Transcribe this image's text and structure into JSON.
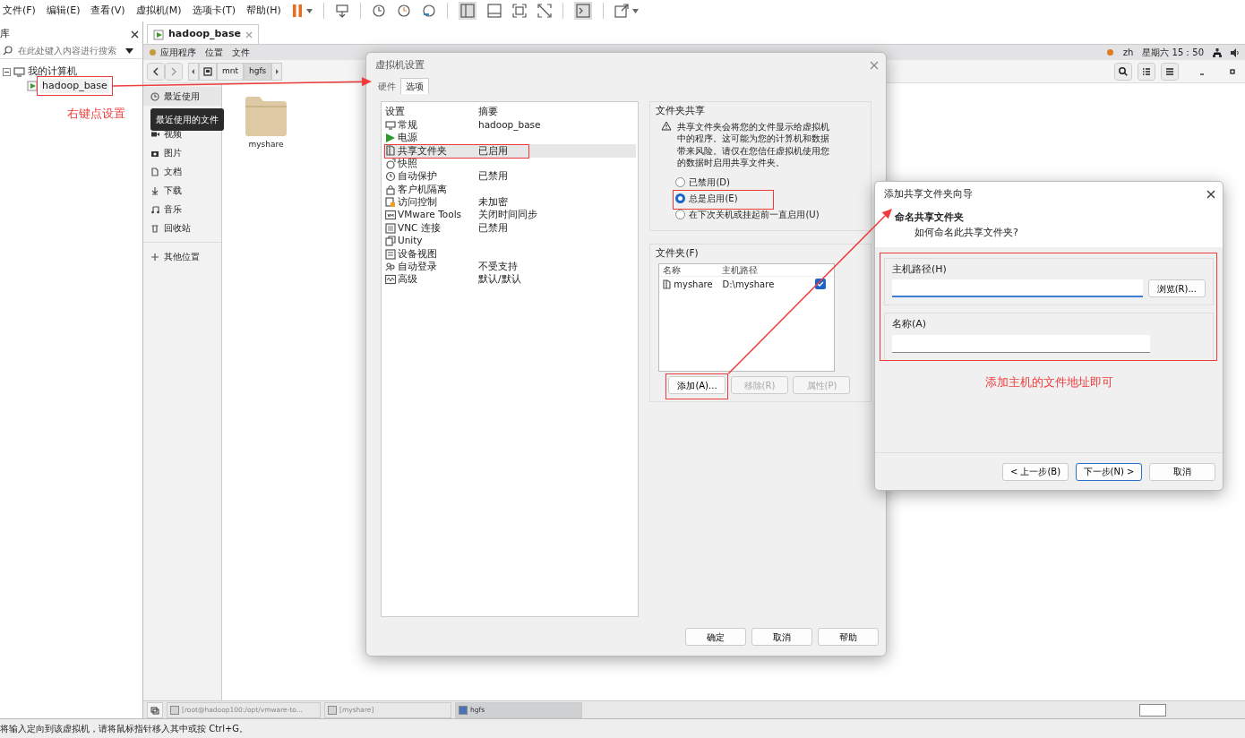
{
  "menubar": {
    "items": [
      "文件(F)",
      "编辑(E)",
      "查看(V)",
      "虚拟机(M)",
      "选项卡(T)",
      "帮助(H)"
    ]
  },
  "library": {
    "title": "库",
    "search": {
      "placeholder": "在此处键入内容进行搜索"
    },
    "tree": [
      {
        "label": "我的计算机",
        "expanded": true,
        "children": [
          {
            "label": "hadoop_base",
            "selected": false
          }
        ]
      }
    ],
    "note": "右键点设置"
  },
  "vm_tabs": [
    {
      "label": "hadoop_base",
      "selected": true
    }
  ],
  "guest_topbar": {
    "menus": [
      "应用程序",
      "位置",
      "文件"
    ],
    "language": "zh",
    "clock": "星期六 15：50"
  },
  "file_manager": {
    "path": [
      {
        "label": "mnt",
        "selected": false
      },
      {
        "label": "hgfs",
        "selected": true
      }
    ],
    "places": [
      {
        "label": "最近使用",
        "tooltip": "最近使用的文件"
      },
      {
        "kind": "hidden"
      },
      {
        "label": "视频"
      },
      {
        "label": "图片"
      },
      {
        "label": "文档"
      },
      {
        "label": "下载"
      },
      {
        "label": "音乐"
      },
      {
        "label": "回收站"
      },
      {
        "kind": "divider"
      },
      {
        "label": "其他位置"
      }
    ],
    "files": [
      {
        "name": "myshare"
      }
    ]
  },
  "settings_dialog": {
    "title": "虚拟机设置",
    "tabs": [
      {
        "label": "硬件",
        "selected": false
      },
      {
        "label": "选项",
        "selected": true
      }
    ],
    "columns": [
      "设置",
      "摘要"
    ],
    "rows": [
      {
        "setting": "常规",
        "summary": "hadoop_base",
        "selected": false
      },
      {
        "setting": "电源",
        "selected": false
      },
      {
        "setting": "共享文件夹",
        "summary": "已启用",
        "selected": true
      },
      {
        "setting": "快照",
        "selected": false
      },
      {
        "setting": "自动保护",
        "summary": "已禁用",
        "selected": false
      },
      {
        "setting": "客户机隔离",
        "selected": false
      },
      {
        "setting": "访问控制",
        "summary": "未加密",
        "selected": false
      },
      {
        "setting": "VMware Tools",
        "summary": "关闭时间同步",
        "selected": false
      },
      {
        "setting": "VNC 连接",
        "summary": "已禁用",
        "selected": false
      },
      {
        "setting": "Unity",
        "selected": false
      },
      {
        "setting": "设备视图",
        "selected": false
      },
      {
        "setting": "自动登录",
        "summary": "不受支持",
        "selected": false
      },
      {
        "setting": "高级",
        "summary": "默认/默认",
        "selected": false
      }
    ],
    "sharing": {
      "title": "文件夹共享",
      "warning": "共享文件夹会将您的文件显示给虚拟机中的程序。这可能为您的计算机和数据带来风险。请仅在您信任虚拟机使用您的数据时启用共享文件夹。",
      "options": [
        {
          "label": "已禁用(D)",
          "selected": false
        },
        {
          "label": "总是启用(E)",
          "selected": true
        },
        {
          "label": "在下次关机或挂起前一直启用(U)",
          "selected": false
        }
      ]
    },
    "folders": {
      "title": "文件夹(F)",
      "columns": [
        "名称",
        "主机路径"
      ],
      "rows": [
        {
          "name": "myshare",
          "path": "D:\\myshare",
          "checked": true
        }
      ],
      "buttons": [
        {
          "label": "添加(A)...",
          "disabled": false
        },
        {
          "label": "移除(R)",
          "disabled": true
        },
        {
          "label": "属性(P)",
          "disabled": true
        }
      ]
    },
    "buttons": [
      "确定",
      "取消",
      "帮助"
    ]
  },
  "wizard": {
    "title": "添加共享文件夹向导",
    "heading": "命名共享文件夹",
    "subheading": "如何命名此共享文件夹?",
    "fields": [
      {
        "label": "主机路径(H)",
        "focused": true,
        "button": "浏览(R)..."
      },
      {
        "label": "名称(A)",
        "focused": false
      }
    ],
    "note": "添加主机的文件地址即可",
    "buttons": [
      {
        "label": "< 上一步(B)",
        "default": false
      },
      {
        "label": "下一步(N) >",
        "default": true
      },
      {
        "label": "取消",
        "default": false
      }
    ]
  },
  "taskbar": [
    {
      "label": "[root@hadoop100:/opt/vmware-to...",
      "selected": false
    },
    {
      "label": "[myshare]",
      "selected": false
    },
    {
      "label": "hgfs",
      "selected": true
    }
  ],
  "status": "将输入定向到该虚拟机，请将鼠标指针移入其中或按 Ctrl+G。"
}
